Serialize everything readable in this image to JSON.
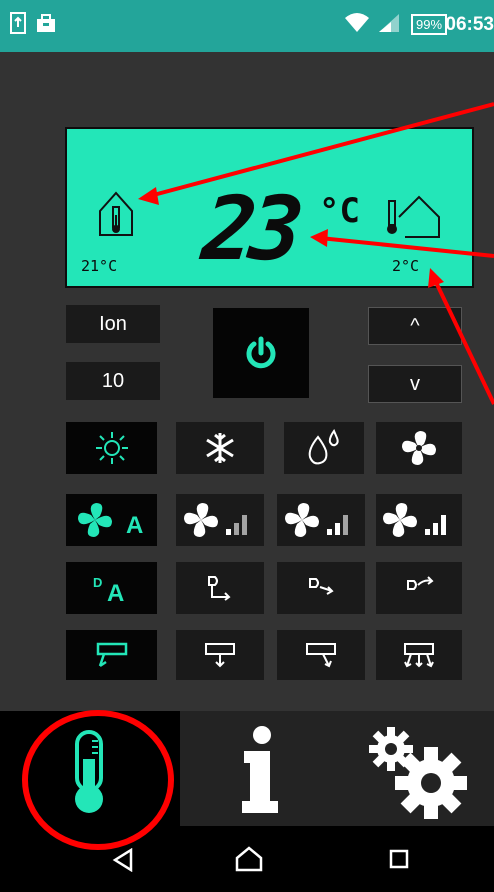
{
  "statusbar": {
    "battery": "99%",
    "time": "06:53",
    "icons": [
      "sim-icon",
      "bag-icon",
      "wifi-icon",
      "signal-icon"
    ]
  },
  "lcd": {
    "temp": "23",
    "unit": "°C",
    "indoor_temp": "21°C",
    "outdoor_temp": "2°C"
  },
  "controls": {
    "ion_label": "Ion",
    "timer_value": "10",
    "up_label": "^",
    "down_label": "v"
  },
  "colors": {
    "accent": "#23e6b8",
    "status": "#23a59a",
    "annotation": "#ff0000"
  },
  "tabs": [
    "thermometer-icon",
    "info-icon",
    "settings-icon"
  ],
  "nav": [
    "back-icon",
    "home-icon",
    "recent-icon"
  ]
}
